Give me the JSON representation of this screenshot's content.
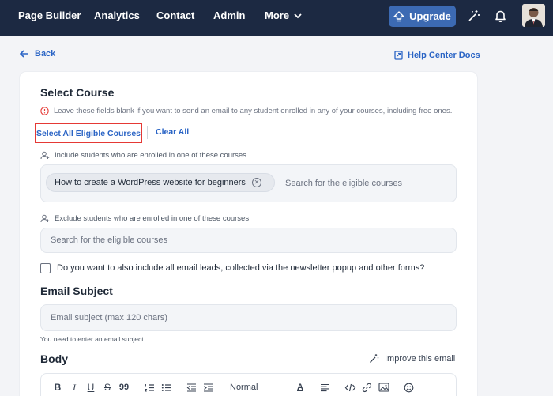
{
  "nav": {
    "items": [
      "Page Builder",
      "Analytics",
      "Contact",
      "Admin"
    ],
    "more_label": "More",
    "upgrade_label": "Upgrade"
  },
  "header": {
    "back_label": "Back",
    "help_label": "Help Center Docs"
  },
  "course": {
    "title": "Select Course",
    "info": "Leave these fields blank if you want to send an email to any student enrolled in any of your courses, including free ones.",
    "select_all_label": "Select All Eligible Courses",
    "clear_all_label": "Clear All",
    "include_hint": "Include students who are enrolled in one of these courses.",
    "selected_course": "How to create a WordPress website for beginners",
    "include_placeholder": "Search for the eligible courses",
    "exclude_hint": "Exclude students who are enrolled in one of these courses.",
    "exclude_placeholder": "Search for the eligible courses",
    "leads_label": "Do you want to also include all email leads, collected via the newsletter popup and other forms?",
    "leads_checked": false
  },
  "subject": {
    "title": "Email Subject",
    "placeholder": "Email subject (max 120 chars)",
    "error": "You need to enter an email subject."
  },
  "body": {
    "title": "Body",
    "improve_label": "Improve this email",
    "toolbar": {
      "bold": "B",
      "italic": "I",
      "underline": "U",
      "strike": "S",
      "quote": "99",
      "format_value": "Normal",
      "text_color": "A"
    }
  },
  "colors": {
    "nav_bg": "#1c2942",
    "accent": "#2a64c5",
    "upgrade_bg": "#3c6ab3",
    "highlight_border": "#e53935"
  }
}
